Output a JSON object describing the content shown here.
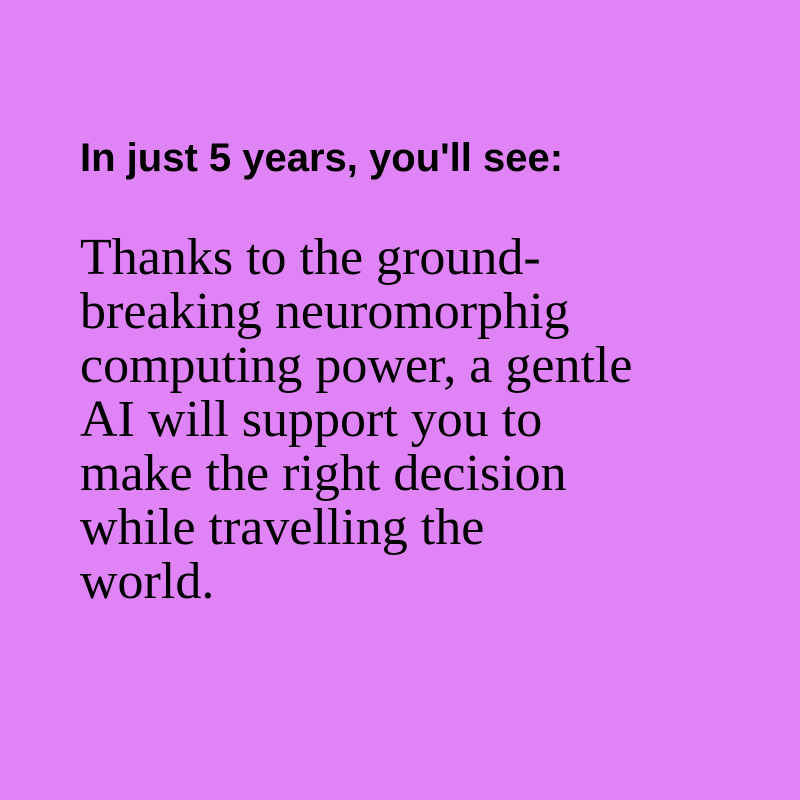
{
  "theme": {
    "background": "#df83f6",
    "text_color": "#000000"
  },
  "heading": "In just 5 years, you'll see:",
  "body_lines": [
    "Thanks to the ground-",
    "breaking neuromorphig",
    "computing power, a gentle",
    "AI will support you to",
    "make the right decision",
    "while travelling the",
    "world."
  ]
}
